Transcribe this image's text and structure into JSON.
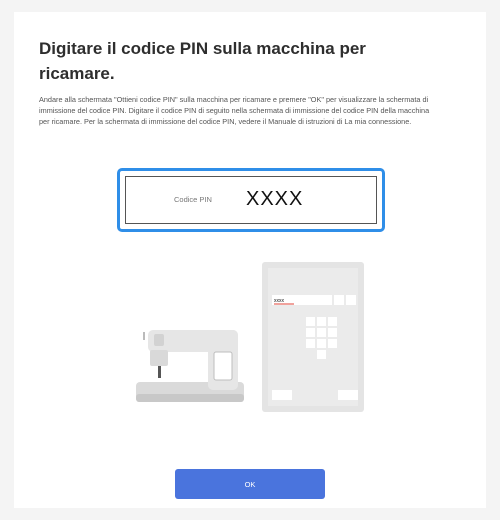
{
  "dialog": {
    "title": "Digitare il codice PIN sulla macchina per ricamare.",
    "description": "Andare alla schermata \"Ottieni codice PIN\" sulla macchina per ricamare e premere \"OK\" per visualizzare la schermata di immissione del codice PIN. Digitare il codice PIN di seguito nella schermata di immissione del codice PIN della macchina per ricamare. Per la schermata di immissione del codice PIN, vedere il Manuale di istruzioni di La mia connessione."
  },
  "pin": {
    "label": "Codice PIN",
    "value": "XXXX"
  },
  "illustration": {
    "screen_code": "xxxx"
  },
  "ok_button": {
    "label": "OK"
  },
  "colors": {
    "accent_border": "#2f8ee8",
    "ok_button": "#4a74dd",
    "screen_code_underline": "#e0463a"
  },
  "icons": [
    "sewing-machine-icon",
    "pin-entry-screen-icon"
  ]
}
